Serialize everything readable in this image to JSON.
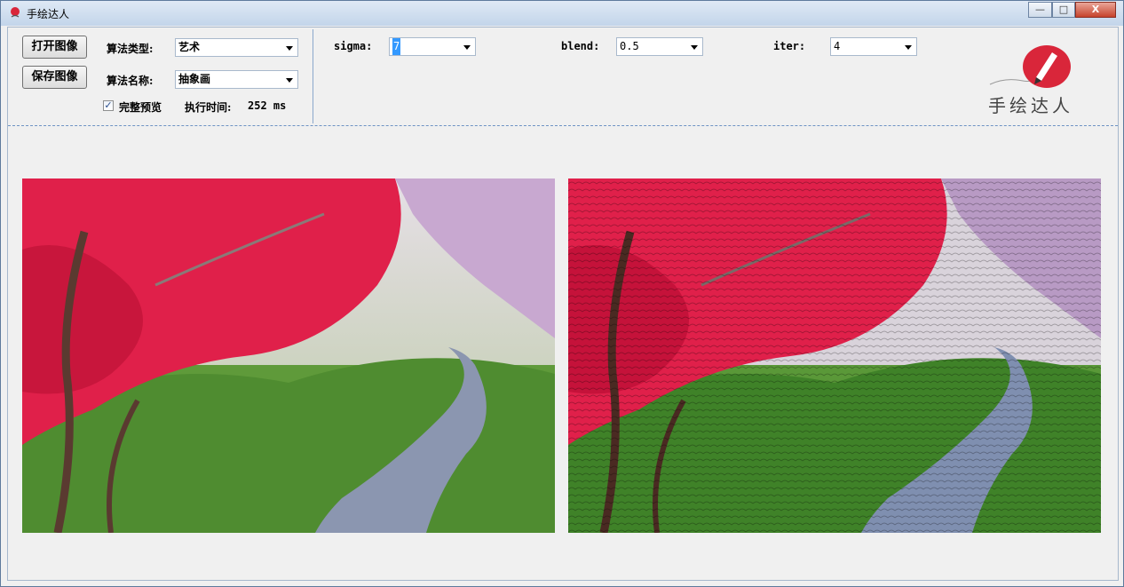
{
  "window": {
    "title": "手绘达人",
    "minimize": "—",
    "maximize": "□",
    "close": "X"
  },
  "toolbar": {
    "open_button": "打开图像",
    "save_button": "保存图像",
    "algo_type_label": "算法类型:",
    "algo_type_value": "艺术",
    "algo_name_label": "算法名称:",
    "algo_name_value": "抽象画",
    "full_preview_label": "完整预览",
    "full_preview_checked": true,
    "exec_time_label": "执行时间:",
    "exec_time_value": "252 ms"
  },
  "params": {
    "sigma_label": "sigma:",
    "sigma_value": "7",
    "blend_label": "blend:",
    "blend_value": "0.5",
    "iter_label": "iter:",
    "iter_value": "4"
  },
  "logo": {
    "text": "手绘达人",
    "accent": "#d9263a"
  },
  "images": {
    "original": {
      "name": "original-image",
      "palette": [
        "#e0204a",
        "#7aa84a",
        "#8b96b0"
      ]
    },
    "processed": {
      "name": "processed-image",
      "palette": [
        "#e0204a",
        "#6aa040",
        "#8b96b0"
      ]
    }
  }
}
